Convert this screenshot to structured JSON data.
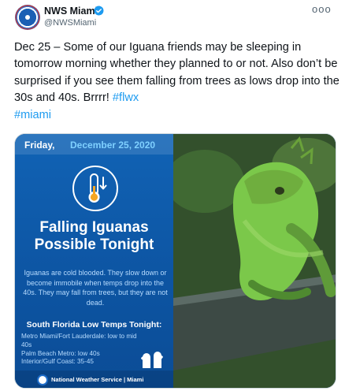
{
  "account": {
    "name": "NWS Miami",
    "handle": "@NWSMiami",
    "verified": true,
    "more_label": "ooo"
  },
  "tweet": {
    "text_main": "Dec 25 – Some of our Iguana friends may be sleeping in tomorrow morning whether they planned to or not. Also don’t be surprised if you see them falling from trees as lows drop into the 30s and 40s. Brrrr! ",
    "hashtag_1": "#flwx",
    "hashtag_2": "#miami"
  },
  "graphic": {
    "day": "Friday,",
    "date": "December 25, 2020",
    "headline_1": "Falling Iguanas",
    "headline_2": "Possible Tonight",
    "body": "Iguanas are cold blooded. They slow down or become immobile when temps drop into the 40s. They may fall from trees, but they are not dead.",
    "temps_title": "South Florida Low Temps Tonight:",
    "temps": [
      "Metro Miami/Fort Lauderdale: low to mid 40s",
      "Palm Beach Metro: low 40s",
      "Interior/Gulf Coast: 35-45"
    ],
    "footer": "National Weather Service | Miami"
  },
  "colors": {
    "link": "#1d9bf0",
    "graphic_blue": "#0d55a3",
    "date_accent": "#7fd0ff",
    "iguana_green": "#7bc84a"
  },
  "icons": {
    "verified": "verified-badge-icon",
    "thermometer": "thermometer-down-icon",
    "mittens": "mittens-icon",
    "noaa": "noaa-logo-icon"
  }
}
